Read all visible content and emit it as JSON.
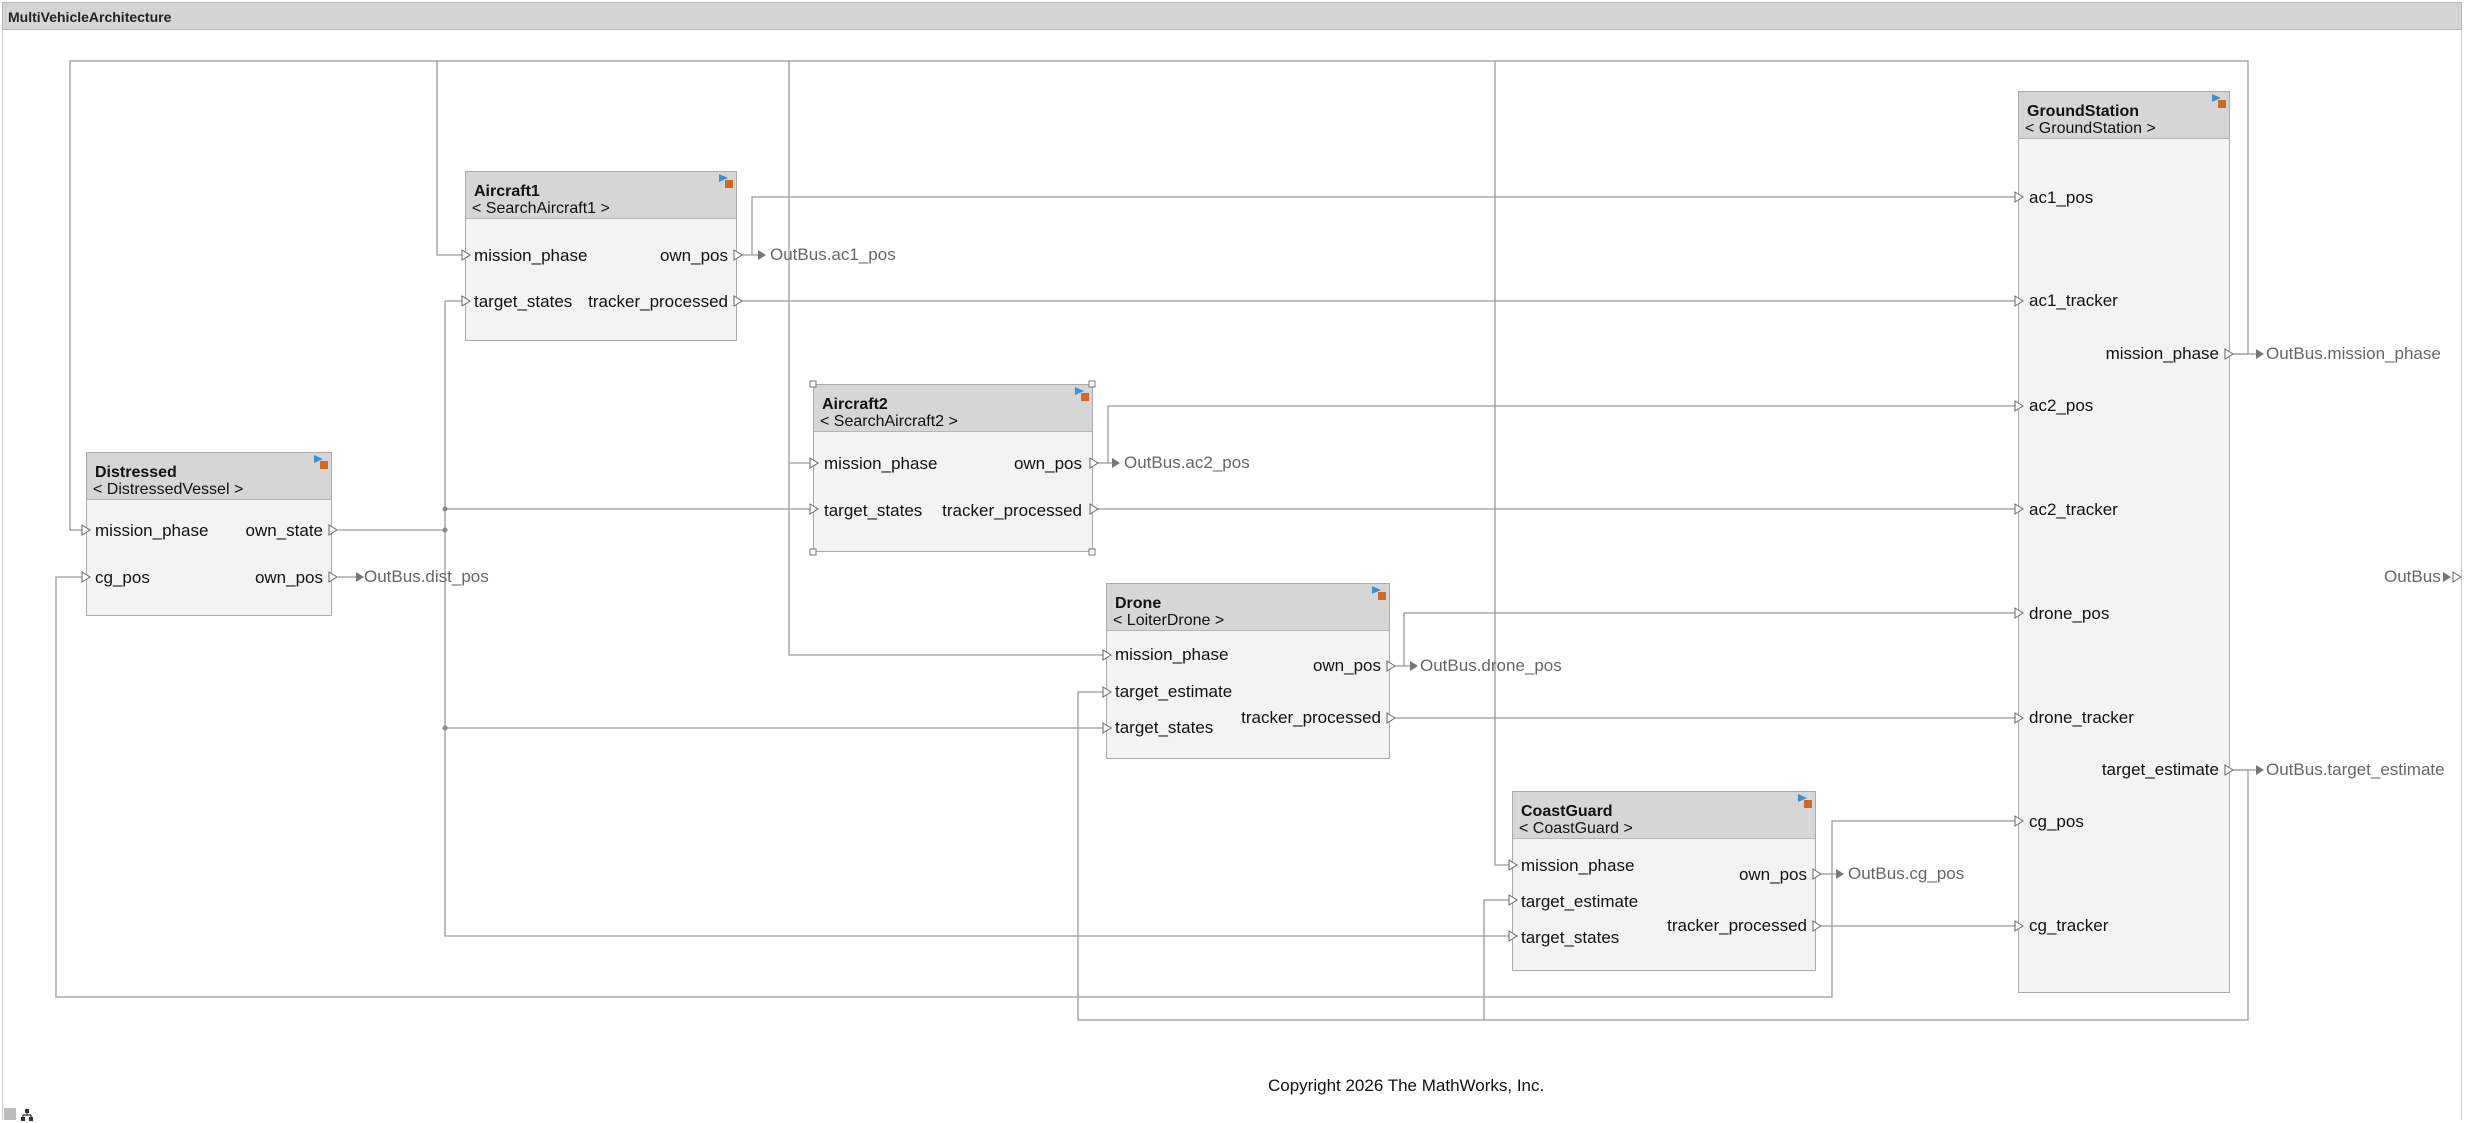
{
  "window": {
    "title": "MultiVehicleArchitecture"
  },
  "blocks": {
    "aircraft1": {
      "name": "Aircraft1",
      "ref": "< SearchAircraft1 >",
      "inputs": [
        "mission_phase",
        "target_states"
      ],
      "outputs": [
        "own_pos",
        "tracker_processed"
      ]
    },
    "aircraft2": {
      "name": "Aircraft2",
      "ref": "< SearchAircraft2 >",
      "inputs": [
        "mission_phase",
        "target_states"
      ],
      "outputs": [
        "own_pos",
        "tracker_processed"
      ]
    },
    "distressed": {
      "name": "Distressed",
      "ref": "< DistressedVessel >",
      "inputs": [
        "mission_phase",
        "cg_pos"
      ],
      "outputs": [
        "own_state",
        "own_pos"
      ]
    },
    "drone": {
      "name": "Drone",
      "ref": "< LoiterDrone >",
      "inputs": [
        "mission_phase",
        "target_estimate",
        "target_states"
      ],
      "outputs": [
        "own_pos",
        "tracker_processed"
      ]
    },
    "coastguard": {
      "name": "CoastGuard",
      "ref": "< CoastGuard >",
      "inputs": [
        "mission_phase",
        "target_estimate",
        "target_states"
      ],
      "outputs": [
        "own_pos",
        "tracker_processed"
      ]
    },
    "groundstation": {
      "name": "GroundStation",
      "ref": "< GroundStation >",
      "inputs": [
        "ac1_pos",
        "ac1_tracker",
        "ac2_pos",
        "ac2_tracker",
        "drone_pos",
        "drone_tracker",
        "cg_pos",
        "cg_tracker"
      ],
      "outputs": [
        "mission_phase",
        "target_estimate"
      ]
    }
  },
  "outbus": {
    "ac1_pos": "OutBus.ac1_pos",
    "ac2_pos": "OutBus.ac2_pos",
    "dist_pos": "OutBus.dist_pos",
    "drone_pos": "OutBus.drone_pos",
    "cg_pos": "OutBus.cg_pos",
    "mission_phase": "OutBus.mission_phase",
    "target_estimate": "OutBus.target_estimate",
    "root": "OutBus"
  },
  "footer": {
    "copyright": "Copyright 2026 The MathWorks, Inc."
  },
  "colors": {
    "wire": "#9a9a9a",
    "block_bg": "#f3f3f3",
    "block_header": "#d6d6d6",
    "titlebar": "#d4d4d4"
  },
  "icons": [
    "subsystem-badge-icon",
    "port-triangle-icon",
    "outbus-arrow-icon",
    "hierarchy-icon"
  ]
}
